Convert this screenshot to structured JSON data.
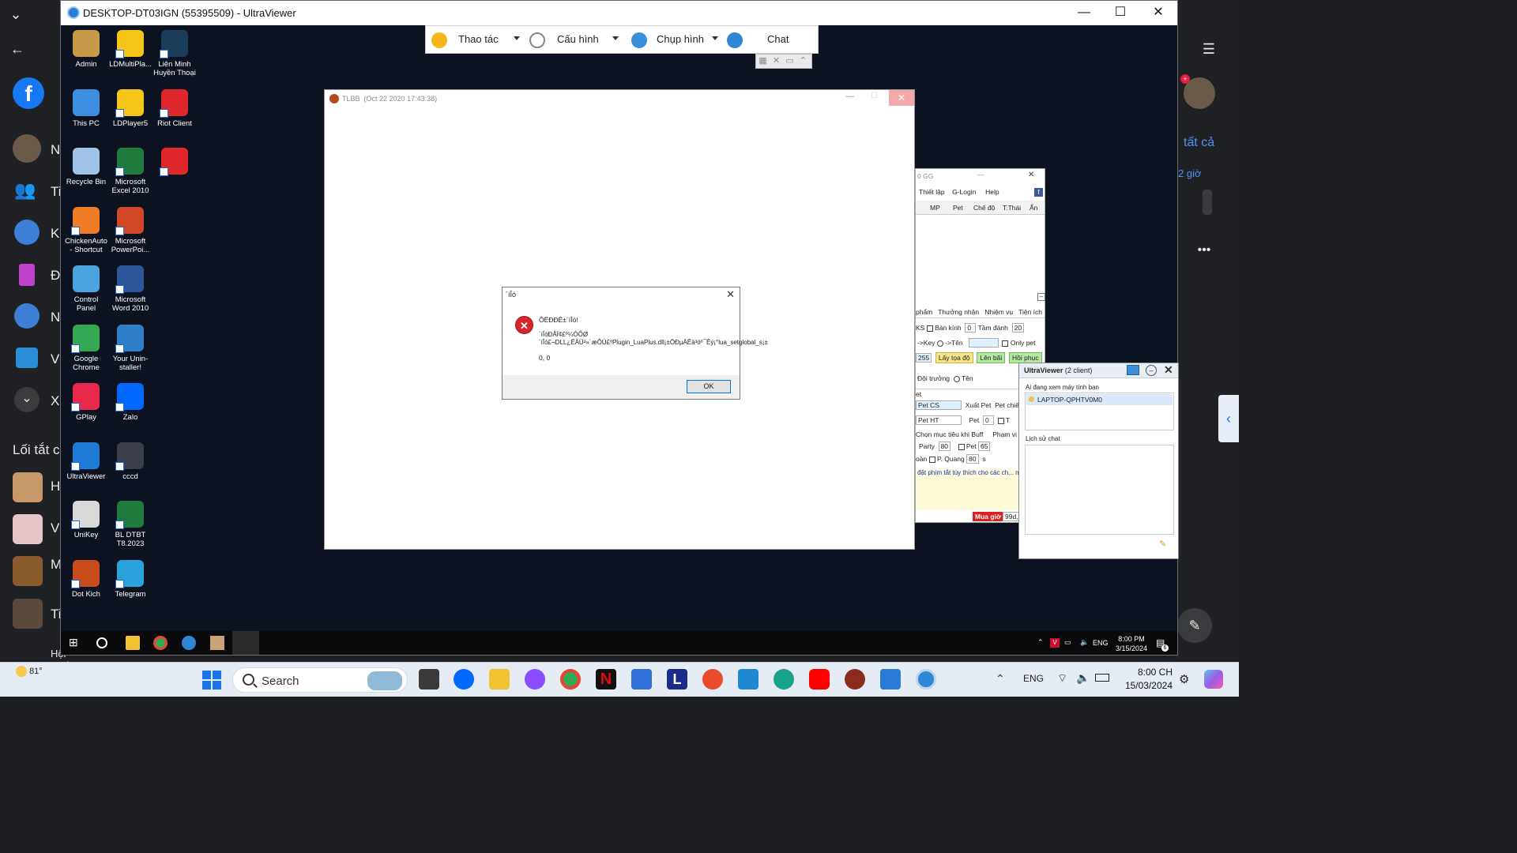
{
  "host": {
    "left_items": [
      "N",
      "Ti",
      "K",
      "Đ",
      "N",
      "V",
      "X"
    ],
    "shortcuts_label": "Lối tắt c",
    "shortcut_items": [
      "H",
      "V",
      "M",
      "Ti",
      "Ti"
    ],
    "bottom_partial": "Hội Quán",
    "right_text_1": "tất cả",
    "right_text_2": "2 giờ"
  },
  "uv": {
    "window_title": "DESKTOP-DT03IGN (55395509) - UltraViewer",
    "toolbar": {
      "action_label": "Thao tác",
      "config_label": "Cấu hình",
      "capture_label": "Chụp hình",
      "chat_label": "Chat"
    }
  },
  "desktop_icons": [
    {
      "label": "Admin",
      "color": "#c79a4a"
    },
    {
      "label": "LDMultiPla...",
      "color": "#f5c518"
    },
    {
      "label": "Liên Minh Huyền Thoại",
      "color": "#1c3d5a"
    },
    {
      "label": "This PC",
      "color": "#3d8ee0"
    },
    {
      "label": "LDPlayer5",
      "color": "#f5c518"
    },
    {
      "label": "Riot Client",
      "color": "#e0272c"
    },
    {
      "label": "Recycle Bin",
      "color": "#9ec3e6"
    },
    {
      "label": "Microsoft Excel 2010",
      "color": "#1f7a3c"
    },
    {
      "label": "",
      "color": "#e0272c"
    },
    {
      "label": "ChickenAuto - Shortcut",
      "color": "#f07c25"
    },
    {
      "label": "Microsoft PowerPoi...",
      "color": "#d24726"
    },
    {
      "label": "Control Panel",
      "color": "#4aa3df"
    },
    {
      "label": "Microsoft Word 2010",
      "color": "#2b579a"
    },
    {
      "label": "Google Chrome",
      "color": "#34a853"
    },
    {
      "label": "Your Unin-staller!",
      "color": "#2f7fc8"
    },
    {
      "label": "GPlay",
      "color": "#e8294b"
    },
    {
      "label": "Zalo",
      "color": "#0068ff"
    },
    {
      "label": "UltraViewer",
      "color": "#1f7ad6"
    },
    {
      "label": "cccd",
      "color": "#3a3f4a"
    },
    {
      "label": "UniKey",
      "color": "#d9d9d9"
    },
    {
      "label": "BL DTBT T8.2023",
      "color": "#1f7a3c"
    },
    {
      "label": "Dot Kich",
      "color": "#c84b1c"
    },
    {
      "label": "Telegram",
      "color": "#2aa3dd"
    }
  ],
  "tlbb": {
    "title": "TLBB",
    "date": "(Oct 22 2020 17:43:38)"
  },
  "dialog": {
    "title": "´íÎó",
    "heading": "ÔËÐÐÊ±´íÎó!",
    "message": "´íÎóÐÅÏ¢£º¼ÓÔØ´íÎó£¬DLL¿ÉÄÜ²»´æÔÚ£ºPlugin_LuaPlus.dll¡±ÖÐµÄÊä³öº¯Êý¡°lua_setglobal_s¡±",
    "code": "0, 0",
    "ok_label": "OK"
  },
  "game_tool": {
    "title": "0 GG",
    "menu": [
      "Thiết lập",
      "G-Login",
      "Help"
    ],
    "columns": [
      "MP",
      "Pet",
      "Chế độ",
      "T.Thái",
      "Ẩn"
    ],
    "tabs": [
      "phẩm",
      "Thưởng nhận",
      "Nhiệm vụ",
      "Tiện ích"
    ],
    "ks_label": "KS",
    "radius_label": "Bán kính",
    "radius_value": "0",
    "range_label": "Tầm đánh",
    "range_value": "20",
    "key_label": "->Key",
    "name_label": "->Tên",
    "only_pet_label": "Only pet",
    "num_value": "255",
    "get_coords_label": "Lấy tọa độ",
    "mount_label": "Lên bãi",
    "revive_label": "Hồi phục",
    "env_label": "Đội trưởng",
    "ten_label": "Tên",
    "pet_section": "et",
    "pet_cs": "Pet CS",
    "xuat_pet": "Xuất Pet",
    "pet_chie": "Pet chiế",
    "pet_ht": "Pet HT",
    "pet_label": "Pet",
    "pet_value": "0",
    "t_label": "T",
    "buff_label": "Chọn mục tiêu khi Buff",
    "pham_vi": "Phạm vi",
    "party_label": "Party",
    "party_value": "80",
    "pet_pct_label": "Pet",
    "pet_pct_value": "65",
    "toan_label": "oàn",
    "pquang_label": "P. Quang",
    "pquang_value": "80",
    "s_label": "s",
    "note": "đặt phím tắt tùy thích cho các ch... nim tắt nút Shift và chọn nhiều tài khoản trên ao tác nhanh nhiều tài khoản cùng lúc",
    "buy_label": "Mua giờ",
    "days_label": "99d,"
  },
  "uv_panel": {
    "title": "UltraViewer",
    "clients": "(2 client)",
    "viewing_label": "Ai đang xem máy tính bạn",
    "client_name": "LAPTOP-QPHTV0M0",
    "chat_history_label": "Lịch sử chat"
  },
  "remote_taskbar": {
    "lang": "ENG",
    "time": "8:00 PM",
    "date": "3/15/2024",
    "badge": "6"
  },
  "taskbar": {
    "weather": "81°",
    "search_label": "Search",
    "lang": "ENG",
    "time": "8:00 CH",
    "date": "15/03/2024"
  }
}
